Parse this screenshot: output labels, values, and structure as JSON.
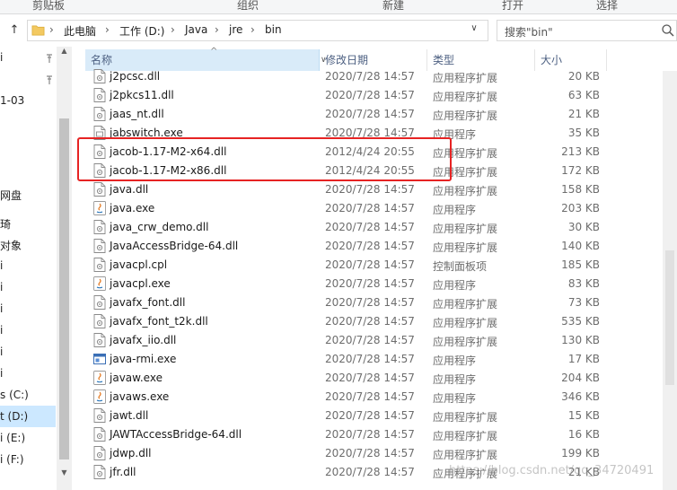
{
  "ribbon": {
    "groups": [
      "剪贴板",
      "组织",
      "新建",
      "打开",
      "选择"
    ]
  },
  "address": {
    "crumbs": [
      "此电脑",
      "工作 (D:)",
      "Java",
      "jre",
      "bin"
    ],
    "search_placeholder": "搜索\"bin\""
  },
  "nav": {
    "items": [
      "i",
      "1-03",
      "网盘",
      "琦",
      "对象",
      "i",
      "i",
      "i",
      "i",
      "i",
      "i",
      "s (C:)",
      "t (D:)",
      "i (E:)",
      "i (F:)"
    ]
  },
  "columns": {
    "name": "名称",
    "date": "修改日期",
    "type": "类型",
    "size": "大小"
  },
  "files": [
    {
      "name": "j2pcsc.dll",
      "date": "2020/7/28 14:57",
      "type": "应用程序扩展",
      "size": "20 KB",
      "icon": "dll-file-icon"
    },
    {
      "name": "j2pkcs11.dll",
      "date": "2020/7/28 14:57",
      "type": "应用程序扩展",
      "size": "63 KB",
      "icon": "dll-file-icon"
    },
    {
      "name": "jaas_nt.dll",
      "date": "2020/7/28 14:57",
      "type": "应用程序扩展",
      "size": "21 KB",
      "icon": "dll-file-icon"
    },
    {
      "name": "jabswitch.exe",
      "date": "2020/7/28 14:57",
      "type": "应用程序",
      "size": "35 KB",
      "icon": "exe-file-icon"
    },
    {
      "name": "jacob-1.17-M2-x64.dll",
      "date": "2012/4/24 20:55",
      "type": "应用程序扩展",
      "size": "213 KB",
      "icon": "dll-file-icon"
    },
    {
      "name": "jacob-1.17-M2-x86.dll",
      "date": "2012/4/24 20:55",
      "type": "应用程序扩展",
      "size": "172 KB",
      "icon": "dll-file-icon"
    },
    {
      "name": "java.dll",
      "date": "2020/7/28 14:57",
      "type": "应用程序扩展",
      "size": "158 KB",
      "icon": "dll-file-icon"
    },
    {
      "name": "java.exe",
      "date": "2020/7/28 14:57",
      "type": "应用程序",
      "size": "203 KB",
      "icon": "java-exe-icon"
    },
    {
      "name": "java_crw_demo.dll",
      "date": "2020/7/28 14:57",
      "type": "应用程序扩展",
      "size": "30 KB",
      "icon": "dll-file-icon"
    },
    {
      "name": "JavaAccessBridge-64.dll",
      "date": "2020/7/28 14:57",
      "type": "应用程序扩展",
      "size": "140 KB",
      "icon": "dll-file-icon"
    },
    {
      "name": "javacpl.cpl",
      "date": "2020/7/28 14:57",
      "type": "控制面板项",
      "size": "185 KB",
      "icon": "dll-file-icon"
    },
    {
      "name": "javacpl.exe",
      "date": "2020/7/28 14:57",
      "type": "应用程序",
      "size": "83 KB",
      "icon": "java-exe-icon"
    },
    {
      "name": "javafx_font.dll",
      "date": "2020/7/28 14:57",
      "type": "应用程序扩展",
      "size": "73 KB",
      "icon": "dll-file-icon"
    },
    {
      "name": "javafx_font_t2k.dll",
      "date": "2020/7/28 14:57",
      "type": "应用程序扩展",
      "size": "535 KB",
      "icon": "dll-file-icon"
    },
    {
      "name": "javafx_iio.dll",
      "date": "2020/7/28 14:57",
      "type": "应用程序扩展",
      "size": "130 KB",
      "icon": "dll-file-icon"
    },
    {
      "name": "java-rmi.exe",
      "date": "2020/7/28 14:57",
      "type": "应用程序",
      "size": "17 KB",
      "icon": "exe-window-icon"
    },
    {
      "name": "javaw.exe",
      "date": "2020/7/28 14:57",
      "type": "应用程序",
      "size": "204 KB",
      "icon": "java-exe-icon"
    },
    {
      "name": "javaws.exe",
      "date": "2020/7/28 14:57",
      "type": "应用程序",
      "size": "346 KB",
      "icon": "java-exe-icon"
    },
    {
      "name": "jawt.dll",
      "date": "2020/7/28 14:57",
      "type": "应用程序扩展",
      "size": "15 KB",
      "icon": "dll-file-icon"
    },
    {
      "name": "JAWTAccessBridge-64.dll",
      "date": "2020/7/28 14:57",
      "type": "应用程序扩展",
      "size": "16 KB",
      "icon": "dll-file-icon"
    },
    {
      "name": "jdwp.dll",
      "date": "2020/7/28 14:57",
      "type": "应用程序扩展",
      "size": "199 KB",
      "icon": "dll-file-icon"
    },
    {
      "name": "jfr.dll",
      "date": "2020/7/28 14:57",
      "type": "应用程序扩展",
      "size": "21 KB",
      "icon": "dll-file-icon"
    }
  ],
  "watermark": "https://blog.csdn.net/qq_34720491",
  "colors": {
    "highlight_box": "#e62323",
    "header_selected": "#d9ebf9",
    "nav_selected": "#cce8ff"
  }
}
